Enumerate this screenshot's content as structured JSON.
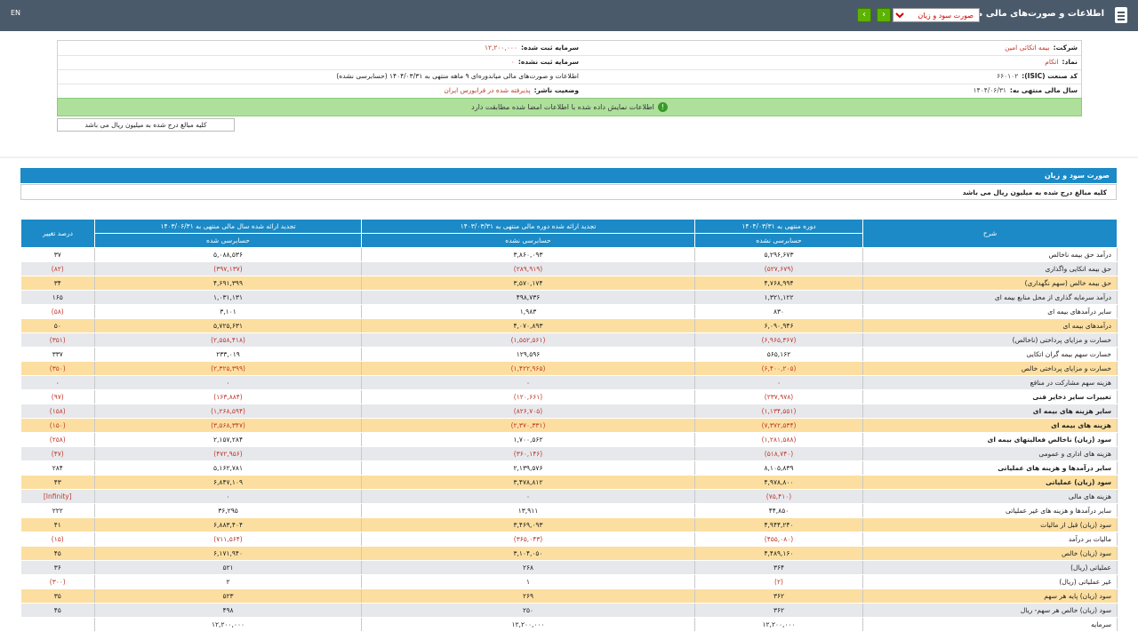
{
  "header": {
    "title": "اطلاعات و صورت‌های مالی میاندوره‌ای",
    "report_select": "صورت سود و زیان",
    "lang": "EN",
    "icons": [
      "document-icon",
      "chevron-left-icon",
      "chevron-right-icon"
    ]
  },
  "company_info": {
    "company_label": "شرکت:",
    "company_value": "بیمه اتکائی امین",
    "symbol_label": "نماد:",
    "symbol_value": "اتکام",
    "isic_label": "کد صنعت (ISIC):",
    "isic_value": "۶۶۰۱۰۲",
    "fiscal_year_label": "سال مالی منتهی به:",
    "fiscal_year_value": "۱۴۰۴/۰۶/۳۱",
    "reg_capital_label": "سرمایه ثبت شده:",
    "reg_capital_value": "۱۲,۲۰۰,۰۰۰",
    "unreg_capital_label": "سرمایه ثبت نشده:",
    "unreg_capital_value": "۰",
    "report_desc": "اطلاعات و صورت‌های مالی میاندوره‌ای ۹ ماهه منتهی به ۱۴۰۴/۰۳/۳۱ (حسابرسی نشده)",
    "status_label": "وضعیت ناشر:",
    "status_value": "پذیرفته شده در فرابورس ایران"
  },
  "alert": {
    "text": "اطلاعات نمایش داده شده با اطلاعات امضا شده مطابقت دارد",
    "icon": "info-icon"
  },
  "unit_note_top": "کلیه مبالغ درج شده به میلیون ریال می باشد",
  "panel": {
    "title": "صورت سود و زیان",
    "unit_note": "کلیه مبالغ درج شده به میلیون ریال می باشد"
  },
  "table": {
    "columns": {
      "desc": "شرح",
      "c1": "دوره منتهی به ۱۴۰۴/۰۳/۳۱",
      "c1_sub": "حسابرسی نشده",
      "c2": "تجدید ارائه شده دوره مالی منتهی به ۱۴۰۳/۰۳/۳۱",
      "c2_sub": "حسابرسی نشده",
      "c3": "تجدید ارائه شده سال مالی منتهی به ۱۴۰۳/۰۶/۳۱",
      "c3_sub": "حسابرسی شده",
      "change": "درصد تغییر"
    },
    "rows": [
      {
        "desc": "درآمد حق بیمه ناخالص",
        "v1": "۵,۲۹۶,۶۷۳",
        "v2": "۳,۸۶۰,۰۹۳",
        "v3": "۵,۰۸۸,۵۳۶",
        "ch": "۳۷",
        "style": "r0"
      },
      {
        "desc": "حق بیمه اتکایی واگذاری",
        "v1": "(۵۲۷,۶۷۹)",
        "v2": "(۲۸۹,۹۱۹)",
        "v3": "(۳۹۷,۱۳۷)",
        "ch": "(۸۲)",
        "style": "r1"
      },
      {
        "desc": "حق بیمه خالص (سهم نگهداری)",
        "v1": "۴,۷۶۸,۹۹۴",
        "v2": "۳,۵۷۰,۱۷۴",
        "v3": "۴,۶۹۱,۳۹۹",
        "ch": "۳۴",
        "style": "r2"
      },
      {
        "desc": "درآمد سرمایه گذاری از محل منابع بیمه ای",
        "v1": "۱,۳۲۱,۱۲۲",
        "v2": "۴۹۸,۷۳۶",
        "v3": "۱,۰۳۱,۱۳۱",
        "ch": "۱۶۵",
        "style": "r1"
      },
      {
        "desc": "سایر درآمدهای بیمه ای",
        "v1": "۸۳۰",
        "v2": "۱,۹۸۳",
        "v3": "۳,۱۰۱",
        "ch": "(۵۸)",
        "style": "r0"
      },
      {
        "desc": "درآمدهای بیمه ای",
        "v1": "۶,۰۹۰,۹۴۶",
        "v2": "۴,۰۷۰,۸۹۳",
        "v3": "۵,۷۲۵,۶۳۱",
        "ch": "۵۰",
        "style": "r2"
      },
      {
        "desc": "خسارت و مزایای پرداختی (ناخالص)",
        "v1": "(۶,۹۶۵,۳۶۷)",
        "v2": "(۱,۵۵۲,۵۶۱)",
        "v3": "(۲,۵۵۸,۴۱۸)",
        "ch": "(۳۵۱)",
        "style": "r1"
      },
      {
        "desc": "خسارت سهم بیمه گران اتکایی",
        "v1": "۵۶۵,۱۶۲",
        "v2": "۱۲۹,۵۹۶",
        "v3": "۲۳۳,۰۱۹",
        "ch": "۳۳۷",
        "style": "r0"
      },
      {
        "desc": "خسارت و مزایای پرداختی خالص",
        "v1": "(۶,۴۰۰,۲۰۵)",
        "v2": "(۱,۴۲۲,۹۶۵)",
        "v3": "(۲,۳۲۵,۳۹۹)",
        "ch": "(۳۵۰)",
        "style": "r2"
      },
      {
        "desc": "هزینه سهم مشارکت در منافع",
        "v1": "۰",
        "v2": "۰",
        "v3": "۰",
        "ch": "۰",
        "style": "r1"
      },
      {
        "desc": "تغییرات سایر ذخایر فنی",
        "v1": "(۲۳۷,۹۷۸)",
        "v2": "(۱۲۰,۶۶۱)",
        "v3": "(۱۶۳,۸۸۴)",
        "ch": "(۹۷)",
        "style": "r0",
        "bold": true
      },
      {
        "desc": "سایر هزینه های بیمه ای",
        "v1": "(۱,۱۳۴,۵۵۱)",
        "v2": "(۸۲۶,۷۰۵)",
        "v3": "(۱,۲۶۸,۵۹۴)",
        "ch": "(۱۵۸)",
        "style": "r1",
        "bold": true
      },
      {
        "desc": "هزینه های بیمه ای",
        "v1": "(۷,۳۷۲,۵۳۴)",
        "v2": "(۲,۳۷۰,۳۳۱)",
        "v3": "(۳,۵۶۸,۳۴۷)",
        "ch": "(۱۵۰)",
        "style": "r2",
        "bold": true
      },
      {
        "desc": "سود (زیان) ناخالص فعالیتهای بیمه ای",
        "v1": "(۱,۲۸۱,۵۸۸)",
        "v2": "۱,۷۰۰,۵۶۲",
        "v3": "۲,۱۵۷,۲۸۴",
        "ch": "(۲۵۸)",
        "style": "r0",
        "bold": true
      },
      {
        "desc": "هزینه های اداری و عمومی",
        "v1": "(۵۱۸,۷۴۰)",
        "v2": "(۳۶۰,۱۴۶)",
        "v3": "(۴۷۲,۹۵۶)",
        "ch": "(۴۷)",
        "style": "r1"
      },
      {
        "desc": "سایر درآمدها و هزینه های عملیاتی",
        "v1": "۸,۱۰۵,۸۳۹",
        "v2": "۲,۱۳۹,۵۷۶",
        "v3": "۵,۱۶۲,۷۸۱",
        "ch": "۲۸۴",
        "style": "r0",
        "bold": true
      },
      {
        "desc": "سود (زیان) عملیاتی",
        "v1": "۴,۹۷۸,۸۰۰",
        "v2": "۳,۴۷۸,۸۱۲",
        "v3": "۶,۸۴۷,۱۰۹",
        "ch": "۴۳",
        "style": "r2",
        "bold": true
      },
      {
        "desc": "هزینه های مالی",
        "v1": "(۷۵,۴۱۰)",
        "v2": "۰",
        "v3": "۰",
        "ch": "[Infinity]",
        "style": "r1"
      },
      {
        "desc": "سایر درآمدها و هزینه های غیر عملیاتی",
        "v1": "۴۴,۸۵۰",
        "v2": "۱۳,۹۱۱",
        "v3": "۳۶,۲۹۵",
        "ch": "۲۲۲",
        "style": "r0"
      },
      {
        "desc": "سود (زیان) قبل از مالیات",
        "v1": "۴,۹۴۴,۲۴۰",
        "v2": "۳,۴۶۹,۰۹۳",
        "v3": "۶,۸۸۳,۴۰۴",
        "ch": "۴۱",
        "style": "r2"
      },
      {
        "desc": "مالیات بر درآمد",
        "v1": "(۴۵۵,۰۸۰)",
        "v2": "(۳۶۵,۰۴۳)",
        "v3": "(۷۱۱,۵۶۴)",
        "ch": "(۱۵)",
        "style": "r0"
      },
      {
        "desc": "سود (زیان) خالص",
        "v1": "۴,۴۸۹,۱۶۰",
        "v2": "۳,۱۰۴,۰۵۰",
        "v3": "۶,۱۷۱,۹۴۰",
        "ch": "۴۵",
        "style": "r2"
      },
      {
        "desc": "عملیاتی (ریال)",
        "v1": "۳۶۴",
        "v2": "۲۶۸",
        "v3": "۵۲۱",
        "ch": "۳۶",
        "style": "r1"
      },
      {
        "desc": "غیر عملیاتی (ریال)",
        "v1": "(۲)",
        "v2": "۱",
        "v3": "۲",
        "ch": "(۳۰۰)",
        "style": "r0"
      },
      {
        "desc": "سود (زیان) پایه هر سهم",
        "v1": "۳۶۲",
        "v2": "۲۶۹",
        "v3": "۵۲۳",
        "ch": "۳۵",
        "style": "r2"
      },
      {
        "desc": "سود (زیان) خالص هر سهم- ریال",
        "v1": "۳۶۲",
        "v2": "۲۵۰",
        "v3": "۴۹۸",
        "ch": "۴۵",
        "style": "r1"
      },
      {
        "desc": "سرمایه",
        "v1": "۱۲,۲۰۰,۰۰۰",
        "v2": "۱۲,۲۰۰,۰۰۰",
        "v3": "۱۲,۲۰۰,۰۰۰",
        "ch": "",
        "style": "r0"
      }
    ]
  },
  "colors": {
    "header_bg": "#4a5a6a",
    "table_header": "#1b8ac6",
    "row_gray": "#e6e8ec",
    "row_gold": "#fcdfa0",
    "negative": "#c0392b",
    "alert_bg": "#aee09c"
  }
}
